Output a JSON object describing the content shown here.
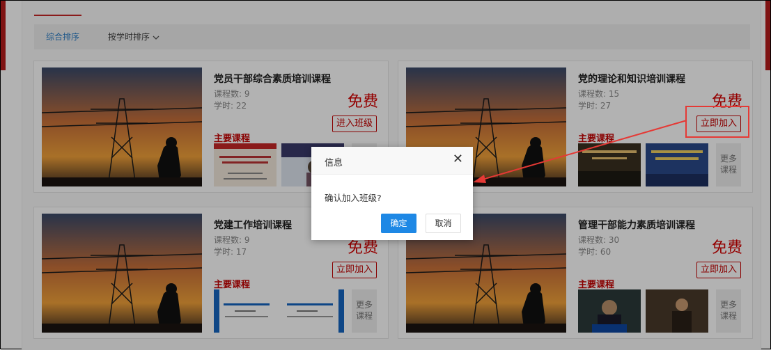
{
  "sort": {
    "comprehensive": "综合排序",
    "by_hours": "按学时排序"
  },
  "labels": {
    "course_count_prefix": "课程数: ",
    "hours_prefix": "学时: ",
    "free": "免费",
    "main_courses": "主要课程",
    "more_line1": "更多",
    "more_line2": "课程"
  },
  "cards": [
    {
      "title": "党员干部综合素质培训课程",
      "courses": "9",
      "hours": "22",
      "button": "进入班级"
    },
    {
      "title": "党的理论和知识培训课程",
      "courses": "15",
      "hours": "27",
      "button": "立即加入"
    },
    {
      "title": "党建工作培训课程",
      "courses": "9",
      "hours": "17",
      "button": "立即加入"
    },
    {
      "title": "管理干部能力素质培训课程",
      "courses": "30",
      "hours": "60",
      "button": "立即加入"
    }
  ],
  "thumb_texts": {
    "c1t1_line": "学习习近平新时代中国特色社会主义思想",
    "c3t1_line": "新时代党支部的工作机制",
    "c3t2_line": "新时代党支部的组织生活",
    "c2t1_line": "习近平总书记关于文化建设的重要论述",
    "c2t2_line": "伟大事业的伟大工程"
  },
  "dialog": {
    "title": "信息",
    "close": "✕",
    "message": "确认加入班级?",
    "ok": "确定",
    "cancel": "取消"
  },
  "colors": {
    "accent": "#c40000",
    "primary": "#1e88e5",
    "highlight": "#e53935"
  }
}
